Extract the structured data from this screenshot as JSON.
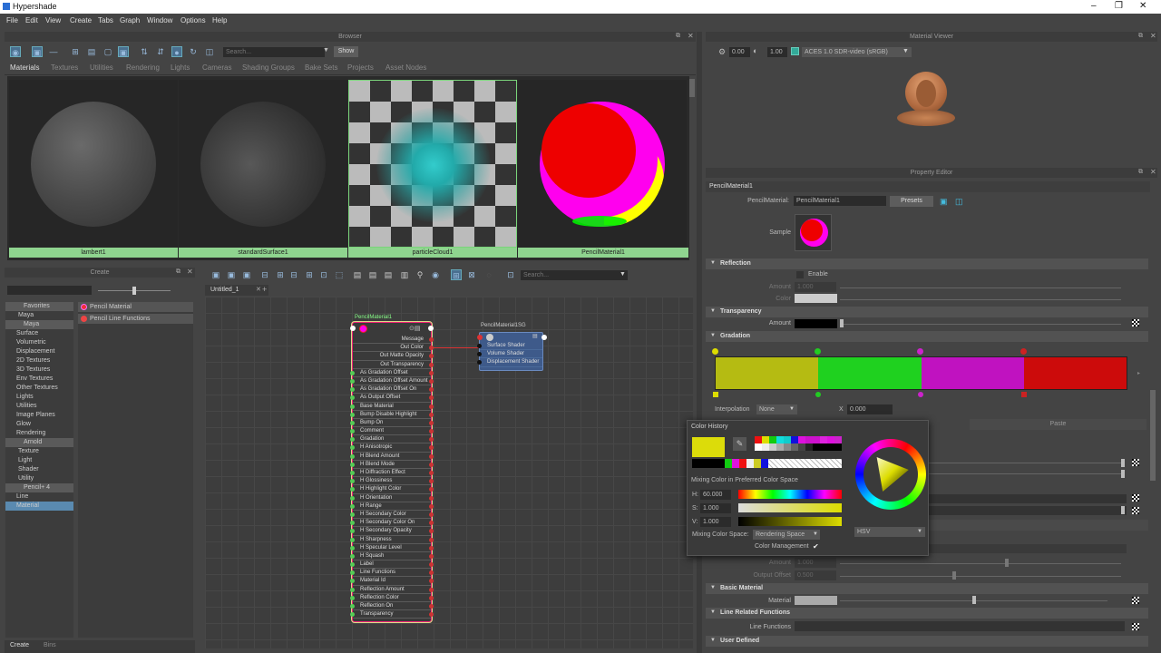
{
  "app": {
    "title": "Hypershade"
  },
  "menu": [
    "File",
    "Edit",
    "View",
    "Create",
    "Tabs",
    "Graph",
    "Window",
    "Options",
    "Help"
  ],
  "browser": {
    "header": "Browser",
    "search_placeholder": "Search...",
    "show_label": "Show",
    "tabs": [
      "Materials",
      "Textures",
      "Utilities",
      "Rendering",
      "Lights",
      "Cameras",
      "Shading Groups",
      "Bake Sets",
      "Projects",
      "Asset Nodes"
    ],
    "swatches": [
      "lambert1",
      "standardSurface1",
      "particleCloud1",
      "PencilMaterial1"
    ]
  },
  "material_viewer": {
    "header": "Material Viewer",
    "val1": "0.00",
    "val2": "1.00",
    "colorspace": "ACES 1.0 SDR-video (sRGB)"
  },
  "create_panel": {
    "header": "Create",
    "tree": [
      {
        "label": "Favorites",
        "type": "hdr"
      },
      {
        "label": "Maya",
        "type": "sub"
      },
      {
        "label": "Maya",
        "type": "hdr"
      },
      {
        "label": "Surface",
        "type": "item"
      },
      {
        "label": "Volumetric",
        "type": "item"
      },
      {
        "label": "Displacement",
        "type": "item"
      },
      {
        "label": "2D Textures",
        "type": "item"
      },
      {
        "label": "3D Textures",
        "type": "item"
      },
      {
        "label": "Env Textures",
        "type": "item"
      },
      {
        "label": "Other Textures",
        "type": "item"
      },
      {
        "label": "Lights",
        "type": "item"
      },
      {
        "label": "Utilities",
        "type": "item"
      },
      {
        "label": "Image Planes",
        "type": "item"
      },
      {
        "label": "Glow",
        "type": "item"
      },
      {
        "label": "Rendering",
        "type": "item"
      },
      {
        "label": "Arnold",
        "type": "hdr"
      },
      {
        "label": "Texture",
        "type": "sub"
      },
      {
        "label": "Light",
        "type": "sub"
      },
      {
        "label": "Shader",
        "type": "sub"
      },
      {
        "label": "Utility",
        "type": "sub"
      },
      {
        "label": "Pencil+ 4",
        "type": "hdr"
      },
      {
        "label": "Line",
        "type": "item"
      },
      {
        "label": "Material",
        "type": "sel"
      }
    ],
    "items": [
      "Pencil Material",
      "Pencil Line Functions"
    ],
    "bottom_tabs": [
      "Create",
      "Bins"
    ]
  },
  "graph": {
    "tab": "Untitled_1",
    "search_placeholder": "Search...",
    "node1": {
      "title": "PencilMaterial1",
      "out_ports": [
        "Message",
        "Out Color",
        "Out Matte Opacity",
        "Out Transparency"
      ],
      "ports": [
        "As Gradation Offset",
        "As Gradation Offset Amount",
        "As Gradation Offset On",
        "As Output Offset",
        "Base Material",
        "Bump Disable Highlight",
        "Bump On",
        "Comment",
        "Gradation",
        "H Anisotropic",
        "H Blend Amount",
        "H Blend Mode",
        "H Diffraction Effect",
        "H Glossiness",
        "H Highlight Color",
        "H Orientation",
        "H Range",
        "H Secondary Color",
        "H Secondary Color On",
        "H Secondary Opacity",
        "H Sharpness",
        "H Specular Level",
        "H Squash",
        "Label",
        "Line Functions",
        "Material Id",
        "Reflection Amount",
        "Reflection Color",
        "Reflection On",
        "Transparency"
      ]
    },
    "node2": {
      "title": "PencilMaterial1SG",
      "ports": [
        "Surface Shader",
        "Volume Shader",
        "Displacement Shader"
      ]
    }
  },
  "property_editor": {
    "header": "Property Editor",
    "node_name": "PencilMaterial1",
    "type_label": "PencilMaterial:",
    "name_value": "PencilMaterial1",
    "presets": "Presets",
    "sample_label": "Sample",
    "sections": {
      "reflection": "Reflection",
      "enable": "Enable",
      "amount": "Amount",
      "amount_val": "1.000",
      "color": "Color",
      "transparency": "Transparency",
      "t_amount": "Amount",
      "gradation": "Gradation",
      "interpolation": "Interpolation",
      "interp_val": "None",
      "x_label": "X",
      "x_val": "0.000",
      "paste": "Paste",
      "amount2": "Amount",
      "amount2_val": "1.000",
      "output_offset": "Output Offset",
      "output_offset_val": "0.500",
      "basic_material": "Basic Material",
      "material": "Material",
      "line_related": "Line Related Functions",
      "line_functions": "Line Functions",
      "user_defined": "User Defined"
    }
  },
  "color_picker": {
    "history_label": "Color History",
    "mixing_label": "Mixing Color in Preferred Color Space",
    "h_label": "H:",
    "h_val": "60.000",
    "s_label": "S:",
    "s_val": "1.000",
    "v_label": "V:",
    "v_val": "1.000",
    "mixing_space_label": "Mixing Color Space:",
    "mixing_space_val": "Rendering Space",
    "color_mgmt": "Color Management",
    "mode": "HSV"
  },
  "colors": {
    "accent_green": "#8fd48f",
    "gradation": [
      "#b5bb12",
      "#1fd11f",
      "#c012c0",
      "#cc0b0b"
    ]
  }
}
